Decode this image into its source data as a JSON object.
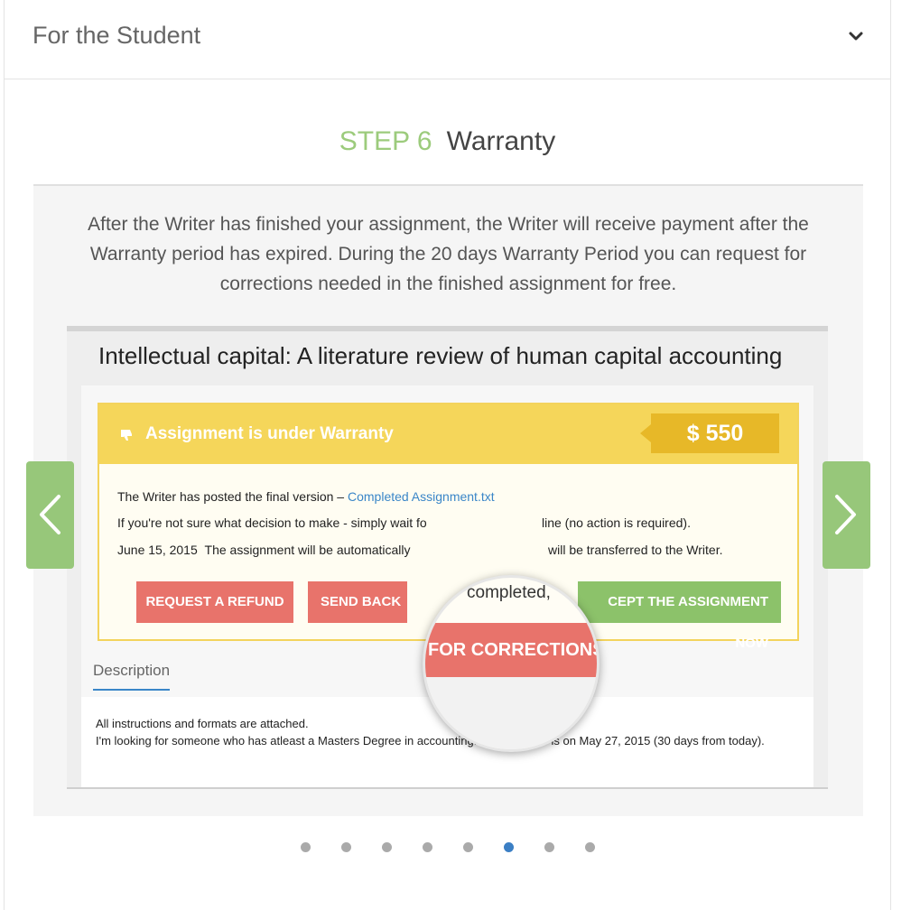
{
  "panel": {
    "title": "For the Student"
  },
  "step": {
    "number": "STEP 6",
    "title": "Warranty",
    "description": "After the Writer has finished your assignment, the Writer will receive payment after the Warranty period has expired. During the 20 days Warranty Period you can request for corrections needed in the finished assignment for free."
  },
  "screenshot": {
    "assignment_title": "Intellectual capital: A literature review of human capital accounting",
    "warranty_label": "Assignment is under Warranty",
    "price": "$ 550",
    "line1_prefix": "The Writer has posted the final version – ",
    "line1_link": "Completed Assignment.txt",
    "line2": "If you're not sure what decision to make - simply wait fo",
    "line2_end": "line (no action is required).",
    "line3_date": "June 15, 2015",
    "line3_text": "The assignment will be automatically",
    "line3_end": "will be transferred to the Writer.",
    "buttons": {
      "refund": "REQUEST A REFUND",
      "send_back": "SEND BACK",
      "accept": "CEPT THE ASSIGNMENT NOW"
    },
    "magnifier": {
      "text": "completed,",
      "button": "FOR CORRECTIONS"
    },
    "description_tab": "Description",
    "description_lines": [
      "All instructions and formats are attached.",
      "I'm looking for someone who has atleast a Masters Degree in accounting. The deadline is on May 27, 2015 (30 days from today)."
    ]
  },
  "carousel": {
    "total_slides": 8,
    "active_slide": 6
  },
  "colors": {
    "accent_green": "#9ccb7c",
    "arrow_green": "#97c77a",
    "warranty_yellow": "#f5d65a",
    "price_gold": "#e7b828",
    "button_red": "#e8736b",
    "button_green": "#8cc26a",
    "link_blue": "#3a86c8",
    "active_dot": "#3b7fc4"
  },
  "icons": {
    "header_toggle": "chevron-down-icon",
    "warranty": "thumbs-down-icon",
    "prev": "chevron-left-icon",
    "next": "chevron-right-icon"
  }
}
